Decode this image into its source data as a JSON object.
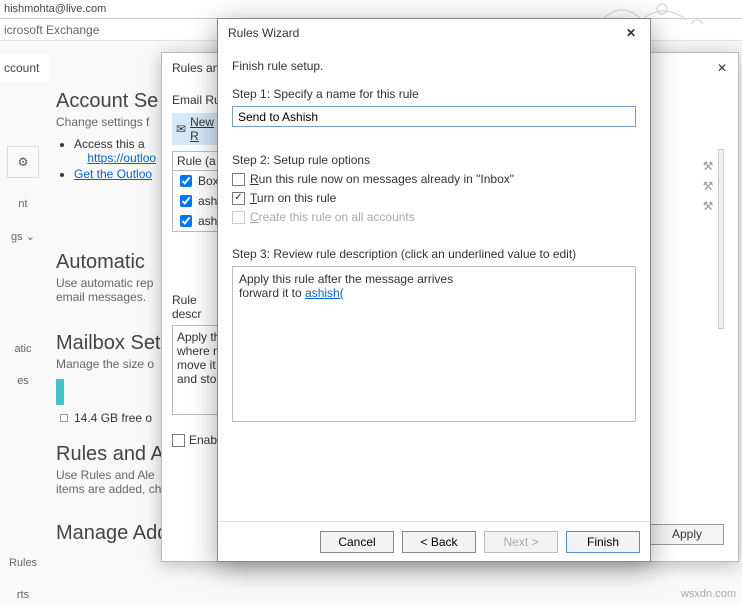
{
  "bg": {
    "email": "hishmohta@live.com",
    "account_type": "icrosoft Exchange",
    "account_label": "ccount",
    "sections": {
      "account": {
        "title": "Account Se",
        "desc": "Change settings f",
        "bullets_a": "Access this a",
        "bullets_link": "https://outloo",
        "bullets_b": "Get the Outloo"
      },
      "auto": {
        "title": "Automatic",
        "desc1": "Use automatic rep",
        "desc2": "email messages."
      },
      "mailbox": {
        "title": "Mailbox Set",
        "desc": "Manage the size o",
        "free": "14.4 GB free o"
      },
      "rules": {
        "title": "Rules and A",
        "desc1": "Use Rules and Ale",
        "desc2": "items are added, changed, or r"
      },
      "addins": {
        "title": "Manage Add-ins"
      }
    },
    "left_labels": {
      "nt": "nt",
      "gs": "gs ⌄",
      "atic": "atic",
      "es": "es",
      "rules": "Rules",
      "rts": "rts"
    },
    "watermark": "wsxdn.com"
  },
  "mid": {
    "title": "Rules and A",
    "tab": "Email Rule",
    "new_rule": "New R",
    "rule_hdr": "Rule (a",
    "rows": [
      "Boxbe",
      "ashish",
      "ashish"
    ],
    "desc_label": "Rule descr",
    "desc_lines": [
      "Apply th",
      "where m",
      "move it t",
      "and sto"
    ],
    "enable": "Enable",
    "apply": "Apply"
  },
  "wizard": {
    "title": "Rules Wizard",
    "heading": "Finish rule setup.",
    "step1_label": "Step 1: Specify a name for this rule",
    "name_value": "Send to Ashish",
    "step2_label": "Step 2: Setup rule options",
    "opt_run": "Run this rule now on messages already in \"Inbox\"",
    "opt_turn": "Turn on this rule",
    "opt_create": "Create this rule on all accounts",
    "step3_label": "Step 3: Review rule description (click an underlined value to edit)",
    "desc_line1": "Apply this rule after the message arrives",
    "desc_line2_a": "forward it to ",
    "desc_line2_link": "ashish(",
    "buttons": {
      "cancel": "Cancel",
      "back": "<  Back",
      "next": "Next >",
      "finish": "Finish"
    }
  }
}
